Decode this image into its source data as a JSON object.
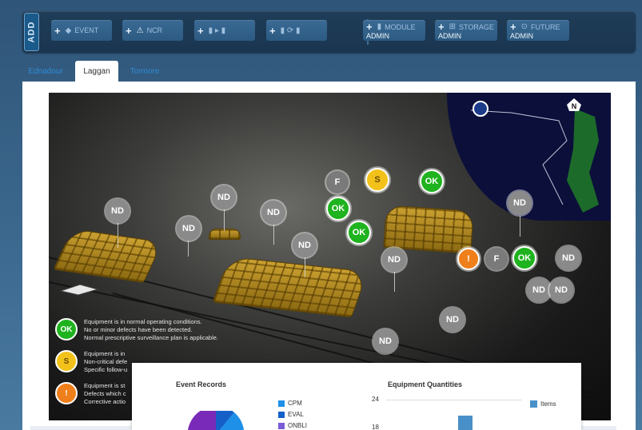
{
  "toolbar": {
    "add_label": "ADD",
    "buttons": [
      {
        "plus": "+",
        "icon": "◆",
        "label": "EVENT"
      },
      {
        "plus": "+",
        "icon": "⚠",
        "label": "NCR"
      },
      {
        "plus": "+",
        "icon": "▮ ▸ ▮",
        "label": ""
      },
      {
        "plus": "+",
        "icon": "▮ ⟳ ▮",
        "label": ""
      }
    ],
    "admin_buttons": [
      {
        "plus": "+",
        "icon": "▮",
        "label": "MODULE",
        "sub": "ADMIN"
      },
      {
        "plus": "+",
        "icon": "⊞",
        "label": "STORAGE",
        "sub": "ADMIN"
      },
      {
        "plus": "+",
        "icon": "⊙",
        "label": "FUTURE",
        "sub": "ADMIN"
      }
    ]
  },
  "tabs": [
    {
      "label": "Ednadour",
      "active": false
    },
    {
      "label": "Laggan",
      "active": true
    },
    {
      "label": "Tormore",
      "active": false
    }
  ],
  "scene": {
    "north_label": "N",
    "markers": {
      "nd": "ND",
      "ok": "OK",
      "f": "F",
      "s": "S",
      "warn": "!"
    }
  },
  "legend": [
    {
      "symbol": "OK",
      "color": "#1fb31f",
      "lines": [
        "Equipment is in normal operating conditions.",
        "No or minor defects have been detected.",
        "Normal prescriptive surveillance plan is applicable."
      ]
    },
    {
      "symbol": "S",
      "color": "#f2c21a",
      "lines": [
        "Equipment is in",
        "Non-critical defe",
        "Specific follow-u"
      ]
    },
    {
      "symbol": "!",
      "color": "#ef7f1a",
      "lines": [
        "Equipment is st",
        "Defects which c",
        "Corrective actio"
      ]
    }
  ],
  "charts": {
    "event_title": "Event Records",
    "event_legend": [
      {
        "label": "CPM",
        "color": "#1e90e8"
      },
      {
        "label": "EVAL",
        "color": "#1460c8"
      },
      {
        "label": "ONBLI",
        "color": "#7a5cd8"
      }
    ],
    "equip_title": "Equipment Quantities",
    "equip_legend": "Items",
    "equip_legend_color": "#4a90c8",
    "y_ticks": [
      "24",
      "18"
    ]
  },
  "chart_data": {
    "type": "bar",
    "title": "Equipment Quantities",
    "series": [
      {
        "name": "Items",
        "values": [
          20
        ]
      }
    ],
    "ylim": [
      0,
      24
    ],
    "yticks": [
      18,
      24
    ]
  }
}
